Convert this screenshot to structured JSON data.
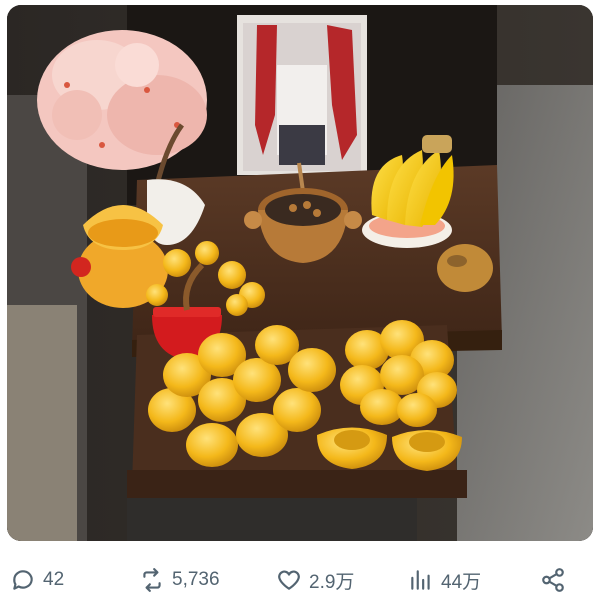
{
  "post": {
    "image": {
      "kind": "photo",
      "subject": "miniature shrine with offerings",
      "poster_figure": "character artwork in red and white"
    },
    "actions": {
      "reply": {
        "icon": "reply-icon",
        "count": "42"
      },
      "repost": {
        "icon": "repost-icon",
        "count": "5,736"
      },
      "like": {
        "icon": "heart-icon",
        "count": "2.9万"
      },
      "views": {
        "icon": "bar-chart-icon",
        "count": "44万"
      },
      "share": {
        "icon": "share-icon"
      }
    }
  },
  "colors": {
    "action_gray": "#536471",
    "gold": "#f0b91c",
    "wood": "#4a3020"
  }
}
